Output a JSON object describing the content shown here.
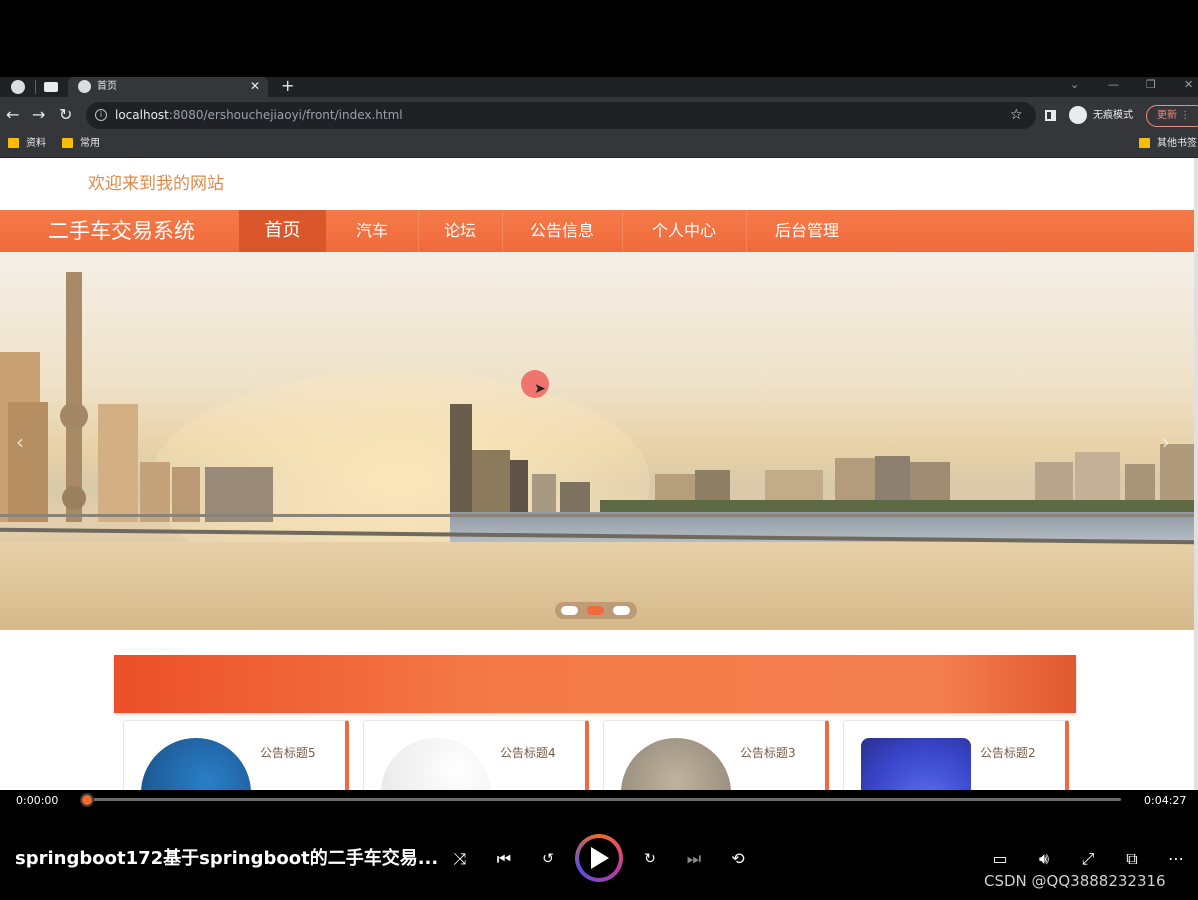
{
  "browser": {
    "tab_title": "首页",
    "url_host": "localhost",
    "url_rest": ":8080/ershouchejiaoyi/front/index.html",
    "incognito_label": "无痕模式",
    "update_label": "更新",
    "bookmarks": [
      "资料",
      "常用"
    ],
    "other_bookmarks": "其他书签"
  },
  "site": {
    "welcome": "欢迎来到我的网站",
    "brand": "二手车交易系统",
    "nav": [
      "首页",
      "汽车",
      "论坛",
      "公告信息",
      "个人中心",
      "后台管理"
    ],
    "active_nav": "首页",
    "carousel_slides": 3,
    "carousel_active_index": 1
  },
  "notices": [
    {
      "title": "公告标题5"
    },
    {
      "title": "公告标题4"
    },
    {
      "title": "公告标题3"
    },
    {
      "title": "公告标题2"
    }
  ],
  "player": {
    "current_time": "0:00:00",
    "duration": "0:04:27",
    "progress": 0,
    "title": "springboot172基于springboot的二手车交易...",
    "watermark": "CSDN @QQ3888232316"
  },
  "colors": {
    "accent": "#f26a3c",
    "nav_active": "#d9572a",
    "welcome": "#e08a4a",
    "player_accent": "#f36a2a"
  },
  "icons": [
    "globe-icon",
    "close-icon",
    "plus-icon",
    "back-icon",
    "forward-icon",
    "reload-icon",
    "info-icon",
    "star-icon",
    "side-panel-icon",
    "incognito-icon",
    "folder-icon",
    "chevron-left-icon",
    "chevron-right-icon",
    "shuffle-icon",
    "previous-icon",
    "rewind-10-icon",
    "play-icon",
    "forward-30-icon",
    "next-icon",
    "loop-off-icon",
    "subtitles-icon",
    "volume-icon",
    "fullscreen-icon",
    "pip-icon",
    "more-icon"
  ]
}
